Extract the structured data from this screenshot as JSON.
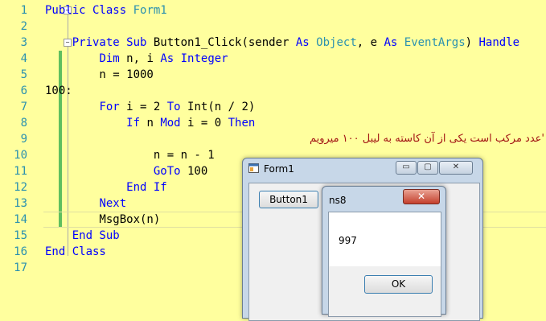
{
  "editor": {
    "line_numbers": [
      "1",
      "2",
      "3",
      "4",
      "5",
      "6",
      "7",
      "8",
      "9",
      "10",
      "11",
      "12",
      "13",
      "14",
      "15",
      "16",
      "17"
    ],
    "lines": {
      "l1": {
        "kw1": "Public Class",
        "name": " Form1"
      },
      "l3": {
        "indent": "    ",
        "kw1": "Private Sub",
        "rest1": " Button1_Click(sender ",
        "kw2": "As",
        "sp": " ",
        "ty1": "Object",
        "rest2": ", e ",
        "kw3": "As",
        "sp2": " ",
        "ty2": "EventArgs",
        "rest3": ") ",
        "kw4": "Handle"
      },
      "l4": {
        "indent": "        ",
        "kw1": "Dim",
        "rest1": " n, i ",
        "kw2": "As",
        "sp": " ",
        "kw3": "Integer"
      },
      "l5": {
        "text": "        n = 1000"
      },
      "l7": {
        "text": "100:"
      },
      "l8": {
        "indent": "        ",
        "kw1": "For",
        "rest1": " i = 2 ",
        "kw2": "To",
        "rest2": " Int(n / 2)"
      },
      "l9": {
        "indent": "            ",
        "kw1": "If",
        "rest1": " n ",
        "kw2": "Mod",
        "rest2": " i = 0 ",
        "kw3": "Then"
      },
      "l10": {
        "comment": "'عدد مرکب است یکی از آن کاسته به لیبل ۱۰۰ میرویم"
      },
      "l11": {
        "text": "                n = n - 1"
      },
      "l12": {
        "indent": "                ",
        "kw1": "GoTo",
        "rest1": " 100"
      },
      "l13": {
        "indent": "            ",
        "kw1": "End If"
      },
      "l14": {
        "indent": "        ",
        "kw1": "Next"
      },
      "l15": {
        "text": "        MsgBox(n)"
      },
      "l16": {
        "indent": "    ",
        "kw1": "End Sub"
      },
      "l17": {
        "kw1": "End Class"
      }
    }
  },
  "form1": {
    "title": "Form1",
    "minimize_glyph": "▭",
    "maximize_glyph": "▢",
    "close_glyph": "✕",
    "button1_label": "Button1"
  },
  "msgbox": {
    "title": "ns8",
    "close_glyph": "✕",
    "message": "997",
    "ok_label": "OK"
  },
  "colors": {
    "editor_background": "#ffff9e",
    "keyword": "#0000ff",
    "type": "#2b91af",
    "string": "#a31515",
    "line_number": "#2b91af",
    "change_marker": "#5fbf5f",
    "close_button": "#c4402d"
  }
}
